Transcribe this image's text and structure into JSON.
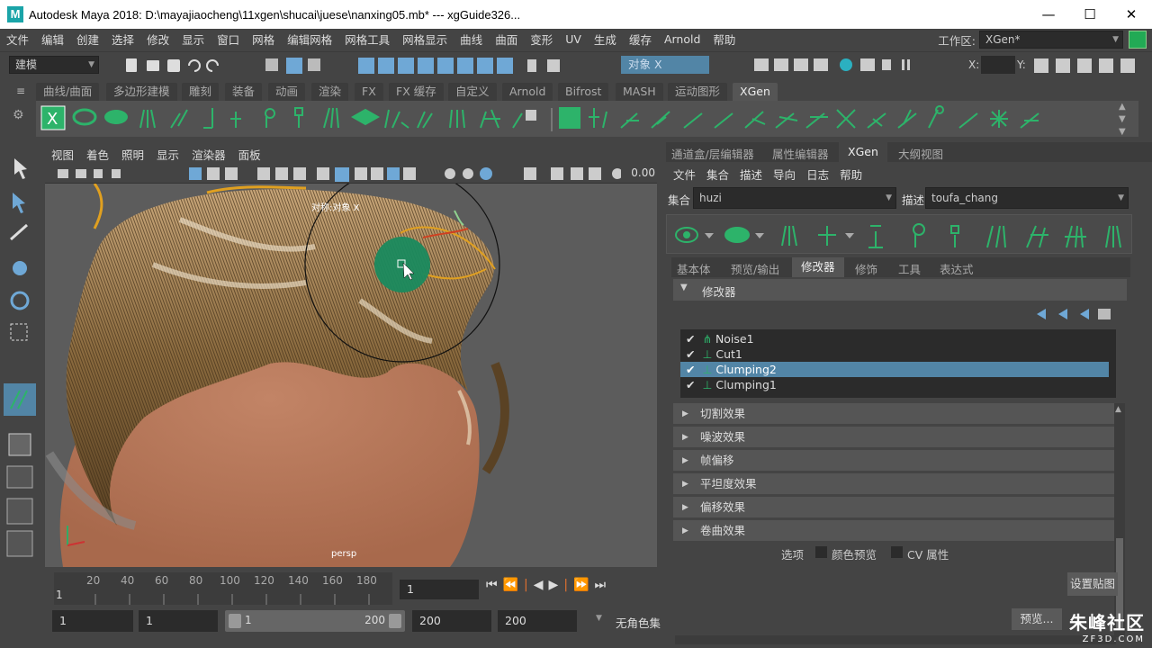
{
  "window": {
    "title": "Autodesk Maya 2018: D:\\mayajiaocheng\\11xgen\\shucai\\juese\\nanxing05.mb*   ---   xgGuide326...",
    "logo": "M",
    "minimize": "—",
    "maximize": "☐",
    "close": "✕"
  },
  "menubar": {
    "items": [
      "文件",
      "编辑",
      "创建",
      "选择",
      "修改",
      "显示",
      "窗口",
      "网格",
      "编辑网格",
      "网格工具",
      "网格显示",
      "曲线",
      "曲面",
      "变形",
      "UV",
      "生成",
      "缓存",
      "Arnold",
      "帮助"
    ],
    "workspace_label": "工作区:",
    "workspace_value": "XGen*"
  },
  "statusline": {
    "mode": "建模",
    "object_field": "对象 X",
    "x_label": "X:",
    "y_label": "Y:"
  },
  "shelf": {
    "tabs": [
      "曲线/曲面",
      "多边形建模",
      "雕刻",
      "装备",
      "动画",
      "渲染",
      "FX",
      "FX 缓存",
      "自定义",
      "Arnold",
      "Bifrost",
      "MASH",
      "运动图形",
      "XGen"
    ],
    "active": "XGen"
  },
  "viewport": {
    "menu": [
      "视图",
      "着色",
      "照明",
      "显示",
      "渲染器",
      "面板"
    ],
    "value_readout": "0.00",
    "symmetry_label": "对称:对象 X",
    "camera": "persp"
  },
  "timeline": {
    "ticks": [
      "20",
      "40",
      "60",
      "80",
      "100",
      "120",
      "140",
      "160",
      "180"
    ],
    "start_frame": "1",
    "current_frame": "1",
    "range_start": "1",
    "range_inner_start": "1",
    "range_inner_start_display": "1",
    "range_inner_end": "200",
    "range_end_a": "200",
    "range_end_b": "200",
    "char_set": "无角色集"
  },
  "right_panel": {
    "tabs": [
      "通道盒/层编辑器",
      "属性编辑器",
      "XGen",
      "大纲视图"
    ],
    "active_tab": "XGen",
    "menu": [
      "文件",
      "集合",
      "描述",
      "导向",
      "日志",
      "帮助"
    ],
    "collection_label": "集合",
    "collection_value": "huzi",
    "description_label": "描述",
    "description_value": "toufa_chang",
    "subtabs": [
      "基本体",
      "预览/输出",
      "修改器",
      "修饰",
      "工具",
      "表达式"
    ],
    "active_subtab": "修改器",
    "modifier_header": "修改器",
    "modifiers": [
      {
        "name": "Noise1",
        "checked": true,
        "selected": false
      },
      {
        "name": "Cut1",
        "checked": true,
        "selected": false
      },
      {
        "name": "Clumping2",
        "checked": true,
        "selected": true
      },
      {
        "name": "Clumping1",
        "checked": true,
        "selected": false
      }
    ],
    "sections": [
      "切割效果",
      "噪波效果",
      "帧偏移",
      "平坦度效果",
      "偏移效果",
      "卷曲效果"
    ],
    "options_label": "选项",
    "color_preview_label": "颜色预览",
    "cv_attr_label": "CV 属性",
    "set_map_button": "设置贴图",
    "preview_button": "预览..."
  },
  "watermark": {
    "brand": "朱峰社区",
    "url": "ZF3D.COM"
  },
  "colors": {
    "accent": "#5285a6",
    "xgen_green": "#2db36a",
    "brush_green": "#1a8a5e"
  }
}
